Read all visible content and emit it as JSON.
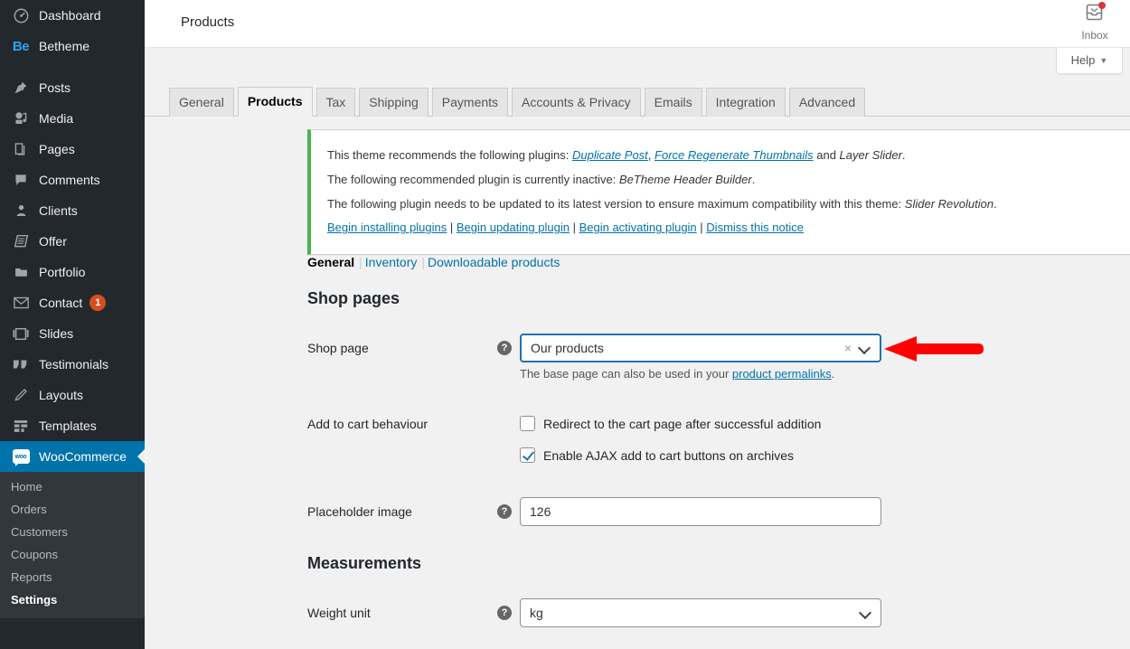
{
  "sidebar": {
    "items": [
      {
        "label": "Dashboard",
        "icon": "dashboard-icon"
      },
      {
        "label": "Betheme",
        "icon": "betheme-logo-icon"
      },
      {
        "label": "Posts",
        "icon": "pin-icon"
      },
      {
        "label": "Media",
        "icon": "media-icon"
      },
      {
        "label": "Pages",
        "icon": "pages-icon"
      },
      {
        "label": "Comments",
        "icon": "comment-icon"
      },
      {
        "label": "Clients",
        "icon": "user-icon"
      },
      {
        "label": "Offer",
        "icon": "offer-icon"
      },
      {
        "label": "Portfolio",
        "icon": "portfolio-icon"
      },
      {
        "label": "Contact",
        "icon": "envelope-icon",
        "badge": "1"
      },
      {
        "label": "Slides",
        "icon": "slides-icon"
      },
      {
        "label": "Testimonials",
        "icon": "quote-icon"
      },
      {
        "label": "Layouts",
        "icon": "pencil-icon"
      },
      {
        "label": "Templates",
        "icon": "templates-icon"
      },
      {
        "label": "WooCommerce",
        "icon": "woocommerce-icon",
        "active": true
      }
    ],
    "submenu": [
      {
        "label": "Home"
      },
      {
        "label": "Orders"
      },
      {
        "label": "Customers"
      },
      {
        "label": "Coupons"
      },
      {
        "label": "Reports"
      },
      {
        "label": "Settings",
        "current": true
      }
    ],
    "accent_active": "#0073aa",
    "badge_color": "#d54e21",
    "background": "#23282d"
  },
  "header": {
    "page_title": "Products",
    "inbox_label": "Inbox",
    "inbox_has_notification": true,
    "help_label": "Help",
    "help_caret": "▼"
  },
  "tabs": [
    {
      "label": "General"
    },
    {
      "label": "Products",
      "active": true
    },
    {
      "label": "Tax"
    },
    {
      "label": "Shipping"
    },
    {
      "label": "Payments"
    },
    {
      "label": "Accounts & Privacy"
    },
    {
      "label": "Emails"
    },
    {
      "label": "Integration"
    },
    {
      "label": "Advanced"
    }
  ],
  "notice": {
    "line1_prefix": "This theme recommends the following plugins: ",
    "line1_link1": "Duplicate Post",
    "line1_sep1": ", ",
    "line1_link2": "Force Regenerate Thumbnails",
    "line1_sep2": " and ",
    "line1_em": "Layer Slider",
    "line1_suffix": ".",
    "line2_prefix": "The following recommended plugin is currently inactive: ",
    "line2_em": "BeTheme Header Builder",
    "line2_suffix": ".",
    "line3_prefix": "The following plugin needs to be updated to its latest version to ensure maximum compatibility with this theme: ",
    "line3_em": "Slider Revolution",
    "line3_suffix": ".",
    "actions": [
      "Begin installing plugins",
      "Begin updating plugin",
      "Begin activating plugin",
      "Dismiss this notice"
    ],
    "dismiss_icon": "×",
    "border_color": "#46b450"
  },
  "subnav": [
    {
      "label": "General",
      "current": true
    },
    {
      "label": "Inventory"
    },
    {
      "label": "Downloadable products"
    }
  ],
  "main": {
    "section_shop_pages": "Shop pages",
    "section_measurements": "Measurements",
    "shop_page": {
      "label": "Shop page",
      "value": "Our products",
      "clear_icon": "×",
      "description_prefix": "The base page can also be used in your ",
      "description_link": "product permalinks",
      "description_suffix": "."
    },
    "add_to_cart": {
      "label": "Add to cart behaviour",
      "checkbox1_label": "Redirect to the cart page after successful addition",
      "checkbox1_checked": false,
      "checkbox2_label": "Enable AJAX add to cart buttons on archives",
      "checkbox2_checked": true
    },
    "placeholder_image": {
      "label": "Placeholder image",
      "value": "126"
    },
    "weight_unit": {
      "label": "Weight unit",
      "value": "kg"
    },
    "help_tip_glyph": "?"
  },
  "annotation": {
    "arrow_color": "#ff0000",
    "points_to": "shop-page-select"
  }
}
